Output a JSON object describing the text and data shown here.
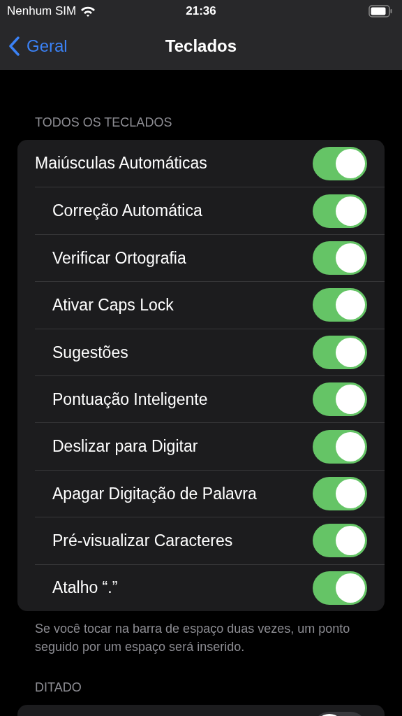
{
  "status_bar": {
    "carrier": "Nenhum SIM",
    "time": "21:36"
  },
  "nav": {
    "back": "Geral",
    "title": "Teclados"
  },
  "sections": [
    {
      "header": "TODOS OS TECLADOS",
      "footer": "Se você tocar na barra de espaço duas vezes, um ponto seguido por um espaço será inserido.",
      "rows": [
        {
          "label": "Maiúsculas Automáticas",
          "on": true
        },
        {
          "label": "Correção Automática",
          "on": true
        },
        {
          "label": "Verificar Ortografia",
          "on": true
        },
        {
          "label": "Ativar Caps Lock",
          "on": true
        },
        {
          "label": "Sugestões",
          "on": true
        },
        {
          "label": "Pontuação Inteligente",
          "on": true
        },
        {
          "label": "Deslizar para Digitar",
          "on": true
        },
        {
          "label": "Apagar Digitação de Palavra",
          "on": true
        },
        {
          "label": "Pré-visualizar Caracteres",
          "on": true
        },
        {
          "label": "Atalho “.”",
          "on": true
        }
      ]
    },
    {
      "header": "DITADO",
      "rows": [
        {
          "on": false
        }
      ]
    }
  ]
}
